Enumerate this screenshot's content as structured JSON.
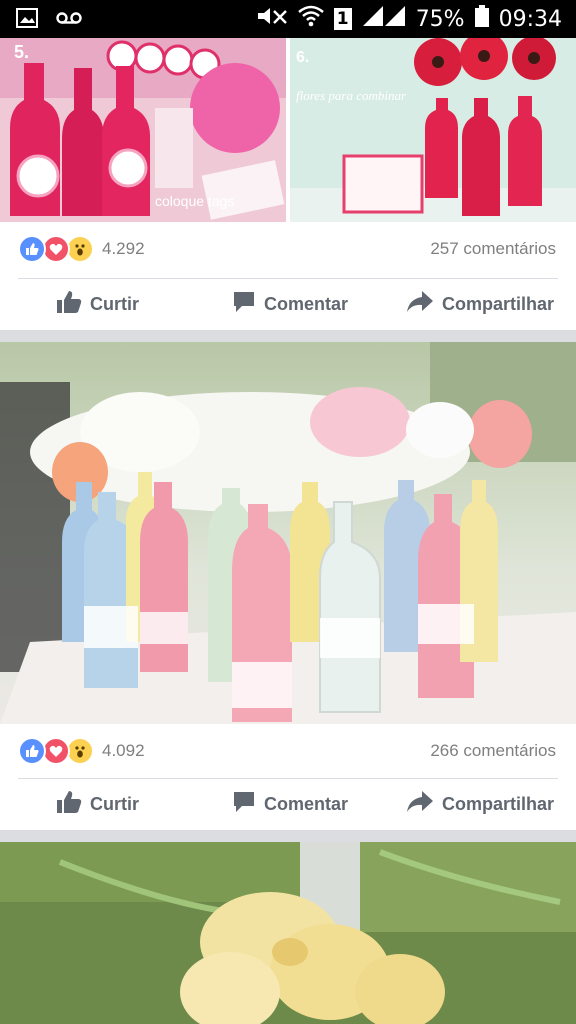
{
  "status_bar": {
    "battery": "75%",
    "time": "09:34",
    "sim_slot": "1"
  },
  "posts": [
    {
      "photo_captions": [
        "5.",
        "6.",
        "coloque tags",
        "flores para combinar"
      ],
      "reaction_count": "4.292",
      "comment_count": "257 comentários",
      "actions": {
        "like": "Curtir",
        "comment": "Comentar",
        "share": "Compartilhar"
      }
    },
    {
      "reaction_count": "4.092",
      "comment_count": "266 comentários",
      "actions": {
        "like": "Curtir",
        "comment": "Comentar",
        "share": "Compartilhar"
      }
    }
  ],
  "colors": {
    "facebook_gray": "#616770",
    "like_blue": "#5890ff",
    "love_red": "#f25268",
    "wow_yellow": "#fcd050"
  },
  "icons": [
    "image-icon",
    "voicemail-icon",
    "mute-icon",
    "wifi-icon",
    "signal-icon",
    "battery-icon",
    "thumbs-up-icon",
    "comment-icon",
    "share-icon"
  ]
}
